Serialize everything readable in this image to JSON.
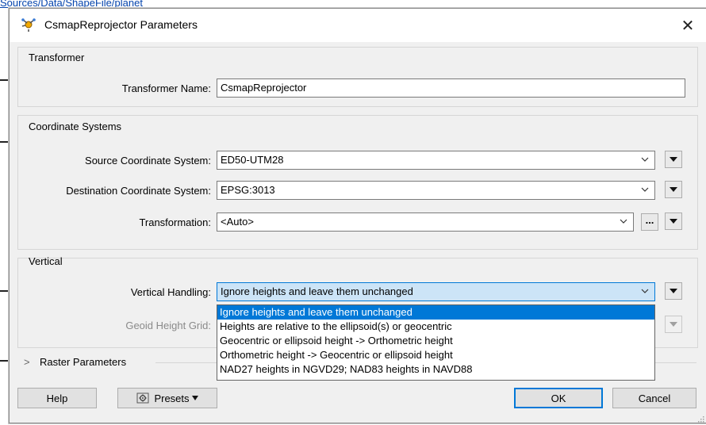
{
  "background": {
    "link_text": "Sources/Data/ShapeFile/planet"
  },
  "dialog": {
    "title": "CsmapReprojector Parameters",
    "close_glyph": "✕"
  },
  "transformer_group": {
    "label": "Transformer",
    "name_label": "Transformer Name:",
    "name_value": "CsmapReprojector"
  },
  "coord_group": {
    "label": "Coordinate Systems",
    "source_label": "Source Coordinate System:",
    "source_value": "ED50-UTM28",
    "dest_label": "Destination Coordinate System:",
    "dest_value": "EPSG:3013",
    "transformation_label": "Transformation:",
    "transformation_value": "<Auto>",
    "ellipsis": "..."
  },
  "vertical_group": {
    "label": "Vertical",
    "handling_label": "Vertical Handling:",
    "handling_value": "Ignore heights and leave them unchanged",
    "geoid_label": "Geoid Height Grid:",
    "options": [
      "Ignore heights and leave them unchanged",
      "Heights are relative to the ellipsoid(s) or geocentric",
      "Geocentric or ellipsoid height -> Orthometric height",
      "Orthometric height -> Geocentric or ellipsoid height",
      "NAD27 heights in NGVD29; NAD83 heights in NAVD88"
    ],
    "selected_index": 0
  },
  "raster": {
    "label": "Raster Parameters",
    "chevron": ">"
  },
  "buttons": {
    "help": "Help",
    "presets": "Presets",
    "ok": "OK",
    "cancel": "Cancel"
  },
  "colors": {
    "accent": "#0078d7",
    "selection_bg": "#cce4f7",
    "dialog_bg": "#f0f0f0"
  }
}
